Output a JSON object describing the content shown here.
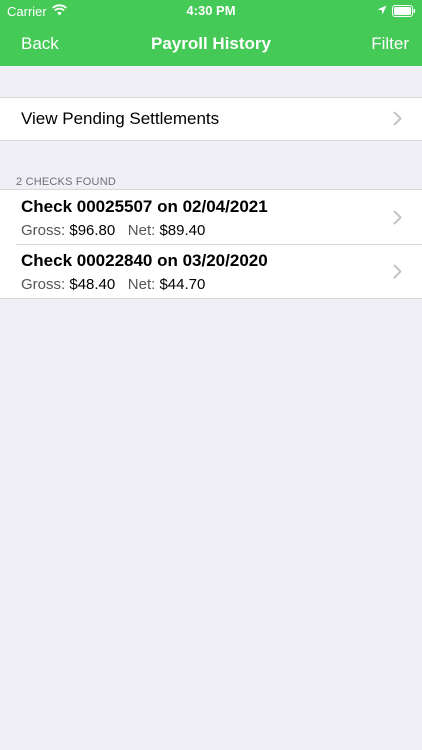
{
  "status_bar": {
    "carrier": "Carrier",
    "time": "4:30 PM"
  },
  "nav": {
    "back_label": "Back",
    "title": "Payroll History",
    "filter_label": "Filter",
    "background_color": "#45c957"
  },
  "pending": {
    "label": "View Pending Settlements"
  },
  "checks_section": {
    "header": "2 CHECKS FOUND",
    "items": [
      {
        "title": "Check 00025507 on 02/04/2021",
        "gross_label": "Gross:",
        "gross_value": "$96.80",
        "net_label": "Net:",
        "net_value": "$89.40"
      },
      {
        "title": "Check 00022840 on 03/20/2020",
        "gross_label": "Gross:",
        "gross_value": "$48.40",
        "net_label": "Net:",
        "net_value": "$44.70"
      }
    ]
  },
  "icons": [
    "wifi-icon",
    "location-icon",
    "battery-icon",
    "chevron-right-icon"
  ]
}
